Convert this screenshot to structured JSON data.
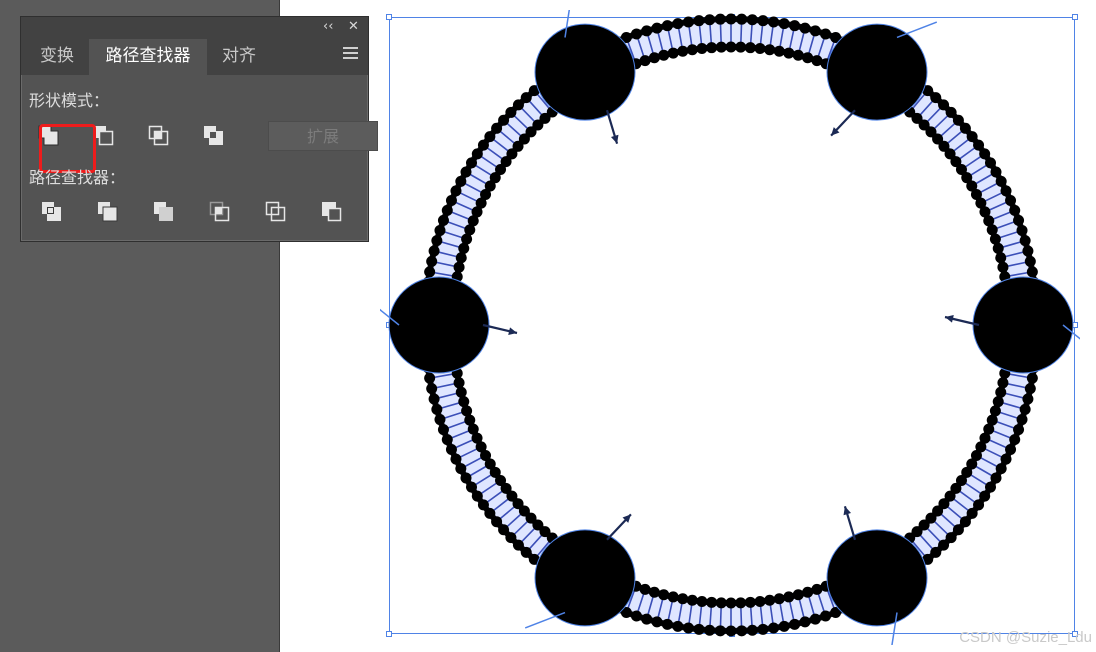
{
  "panel": {
    "titlebar": {
      "collapse_glyph": "‹‹",
      "close_glyph": "✕"
    },
    "tabs": [
      {
        "label": "变换",
        "active": false
      },
      {
        "label": "路径查找器",
        "active": true
      },
      {
        "label": "对齐",
        "active": false
      }
    ],
    "shape_modes": {
      "label": "形状模式：",
      "buttons": [
        {
          "icon": "unite-icon",
          "highlighted": true
        },
        {
          "icon": "minus-front-icon"
        },
        {
          "icon": "intersect-icon"
        },
        {
          "icon": "exclude-icon"
        }
      ],
      "expand_label": "扩展"
    },
    "pathfinders": {
      "label": "路径查找器：",
      "buttons": [
        {
          "icon": "divide-icon"
        },
        {
          "icon": "trim-icon"
        },
        {
          "icon": "merge-icon"
        },
        {
          "icon": "crop-icon"
        },
        {
          "icon": "outline-icon"
        },
        {
          "icon": "minus-back-icon"
        }
      ]
    },
    "colors": {
      "highlight": "#ee1c1c",
      "panel_bg": "#535353"
    }
  },
  "artboard": {
    "selection_color": "#4f83e6",
    "artwork": "membrane-ring-with-protein-channels"
  },
  "watermark": "CSDN @Suzie_Ldu"
}
